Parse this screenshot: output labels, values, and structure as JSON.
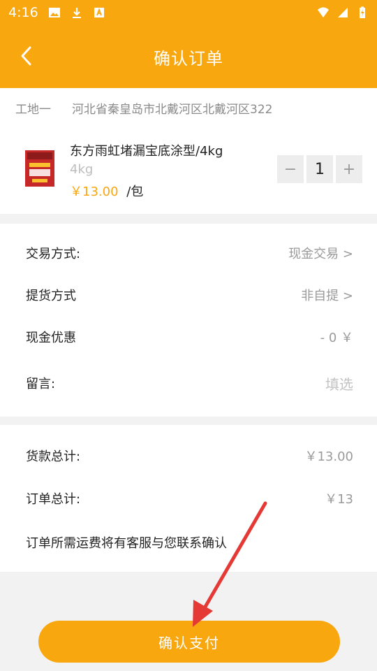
{
  "status_bar": {
    "time": "4:16"
  },
  "header": {
    "title": "确认订单"
  },
  "address": {
    "name": "工地一",
    "text": "河北省秦皇岛市北戴河区北戴河区322"
  },
  "product": {
    "name": "东方雨虹堵漏宝底涂型/4kg",
    "spec": "4kg",
    "price": "￥13.00",
    "unit": "/包",
    "quantity": "1",
    "minus_label": "−",
    "plus_label": "+"
  },
  "options": {
    "trade_label": "交易方式:",
    "trade_value": "现金交易 >",
    "pickup_label": "提货方式",
    "pickup_value": "非自提 >",
    "discount_label": "现金优惠",
    "discount_value": "- 0 ￥",
    "message_label": "留言:",
    "message_placeholder": "填选"
  },
  "summary": {
    "goods_total_label": "货款总计:",
    "goods_total_value": "￥13.00",
    "order_total_label": "订单总计:",
    "order_total_value": "￥13",
    "shipping_note": "订单所需运费将有客服与您联系确认"
  },
  "footer": {
    "pay_button": "确认支付"
  },
  "colors": {
    "accent": "#f9a70f",
    "annotation_arrow": "#e53935"
  }
}
